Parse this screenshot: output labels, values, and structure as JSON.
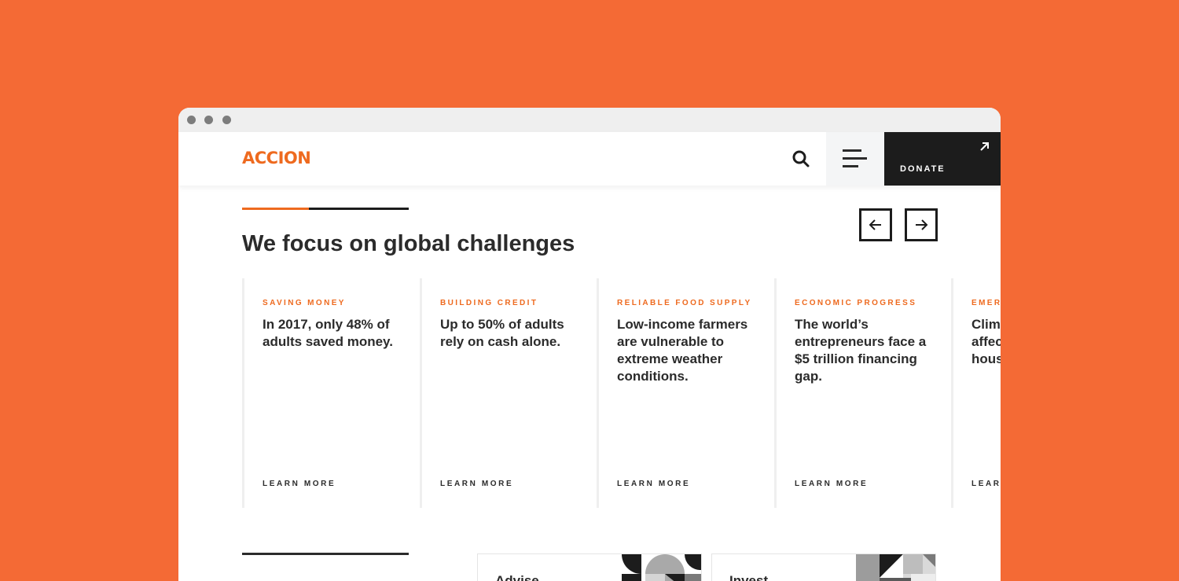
{
  "brand": {
    "logo_text": "ACCION",
    "accent_color": "#ee6a1f",
    "background_color": "#f46a35"
  },
  "header": {
    "search_icon": "search-icon",
    "menu_icon": "hamburger-menu-icon",
    "donate_label": "DONATE",
    "donate_icon": "arrow-up-right-icon"
  },
  "section": {
    "title": "We focus on global challenges",
    "carousel_progress": 0.4,
    "prev_icon": "arrow-left-icon",
    "next_icon": "arrow-right-icon"
  },
  "cards": [
    {
      "category": "SAVING MONEY",
      "text": "In 2017, only 48% of adults saved money.",
      "link": "LEARN MORE"
    },
    {
      "category": "BUILDING CREDIT",
      "text": "Up to 50% of adults rely on cash alone.",
      "link": "LEARN MORE"
    },
    {
      "category": "RELIABLE FOOD SUPPLY",
      "text": "Low-income farmers are vulnerable to extreme weather conditions.",
      "link": "LEARN MORE"
    },
    {
      "category": "ECONOMIC PROGRESS",
      "text": "The world’s entrepreneurs face a $5 trillion financing gap.",
      "link": "LEARN MORE"
    },
    {
      "category": "EMER",
      "text": "Clim affec hous",
      "link": "LEARN"
    }
  ],
  "tiles": [
    {
      "label": "Advise"
    },
    {
      "label": "Invest"
    }
  ]
}
